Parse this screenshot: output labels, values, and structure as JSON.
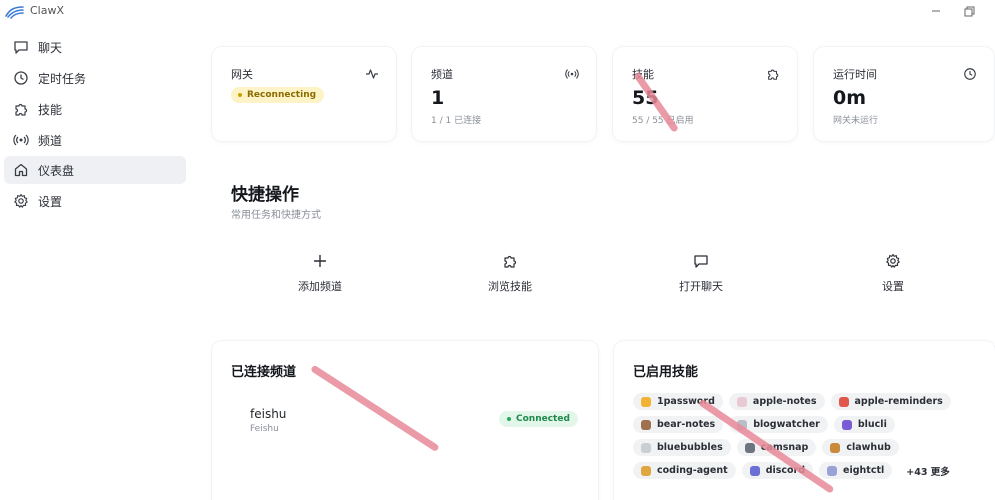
{
  "app": {
    "title": "ClawX"
  },
  "sidebar": {
    "items": [
      {
        "label": "聊天",
        "icon": "chat-icon",
        "active": false
      },
      {
        "label": "定时任务",
        "icon": "clock-icon",
        "active": false
      },
      {
        "label": "技能",
        "icon": "puzzle-icon",
        "active": false
      },
      {
        "label": "频道",
        "icon": "radio-icon",
        "active": false
      },
      {
        "label": "仪表盘",
        "icon": "home-icon",
        "active": true
      },
      {
        "label": "设置",
        "icon": "gear-icon",
        "active": false
      }
    ]
  },
  "stats": {
    "gateway": {
      "title": "网关",
      "status": "Reconnecting",
      "icon": "activity-icon"
    },
    "channels": {
      "title": "频道",
      "value": "1",
      "sub": "1 / 1 已连接",
      "icon": "radio-icon"
    },
    "skills": {
      "title": "技能",
      "value": "55",
      "sub": "55 / 55 已启用",
      "icon": "puzzle-icon"
    },
    "uptime": {
      "title": "运行时间",
      "value": "0m",
      "sub": "网关未运行",
      "icon": "clock-icon"
    }
  },
  "quick_actions": {
    "title": "快捷操作",
    "subtitle": "常用任务和快捷方式",
    "buttons": [
      {
        "label": "添加频道",
        "icon": "plus-icon"
      },
      {
        "label": "浏览技能",
        "icon": "puzzle-icon"
      },
      {
        "label": "打开聊天",
        "icon": "chat-icon"
      },
      {
        "label": "设置",
        "icon": "gear-icon"
      }
    ]
  },
  "connected_channels": {
    "title": "已连接频道",
    "items": [
      {
        "name": "feishu",
        "type": "Feishu",
        "status": "Connected"
      }
    ]
  },
  "enabled_skills": {
    "title": "已启用技能",
    "skills": [
      {
        "name": "1password",
        "color": "#f2b233"
      },
      {
        "name": "apple-notes",
        "color": "#e9c9d2"
      },
      {
        "name": "apple-reminders",
        "color": "#e2574c"
      },
      {
        "name": "bear-notes",
        "color": "#a0714f"
      },
      {
        "name": "blogwatcher",
        "color": "#b9bec6"
      },
      {
        "name": "blucli",
        "color": "#7a5bd6"
      },
      {
        "name": "bluebubbles",
        "color": "#c9cdd4"
      },
      {
        "name": "camsnap",
        "color": "#6d7380"
      },
      {
        "name": "clawhub",
        "color": "#c98b3a"
      },
      {
        "name": "coding-agent",
        "color": "#e0a640"
      },
      {
        "name": "discord",
        "color": "#6b6fd6"
      },
      {
        "name": "eightctl",
        "color": "#9aa3d8"
      }
    ],
    "more_label": "+43 更多"
  },
  "colors": {
    "accent_reconnecting": "#fdf3c7",
    "accent_connected": "#e3f6ea",
    "annotation_stroke": "#e88a98"
  }
}
